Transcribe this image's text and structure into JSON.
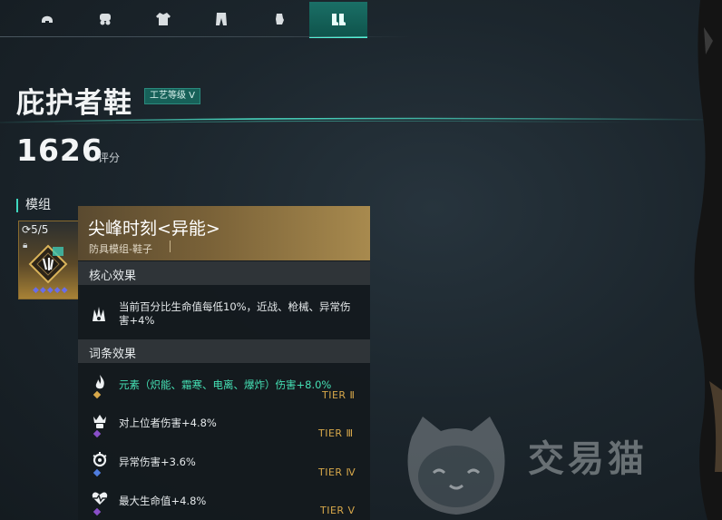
{
  "tabs": [
    {
      "icon": "helmet-icon",
      "active": false
    },
    {
      "icon": "mask-icon",
      "active": false
    },
    {
      "icon": "jacket-icon",
      "active": false
    },
    {
      "icon": "pants-icon",
      "active": false
    },
    {
      "icon": "glove-icon",
      "active": false
    },
    {
      "icon": "boots-icon",
      "active": true
    }
  ],
  "item": {
    "name": "庇护者鞋",
    "craft_level": "工艺等级 V",
    "score": "1626",
    "score_label": "评分"
  },
  "module_section": {
    "label": "模组",
    "slot_count": "5/5"
  },
  "tooltip": {
    "name": "尖峰时刻<异能>",
    "subtitle": "防具模组-鞋子",
    "core_header": "核心效果",
    "core_text": "当前百分比生命值每低10%，近战、枪械、异常伤害+4%",
    "affix_header": "词条效果",
    "affixes": [
      {
        "text": "元素（炽能、霜寒、电离、爆炸）伤害+8.0%",
        "tier": "TIER Ⅱ",
        "highlight": true,
        "icon": "flame-icon",
        "dot_color": "#d8a84a"
      },
      {
        "text": "对上位者伤害+4.8%",
        "tier": "TIER Ⅲ",
        "highlight": false,
        "icon": "crown-skull-icon",
        "dot_color": "#8a4fc9"
      },
      {
        "text": "异常伤害+3.6%",
        "tier": "TIER Ⅳ",
        "highlight": false,
        "icon": "anomaly-icon",
        "dot_color": "#4f7de0"
      },
      {
        "text": "最大生命值+4.8%",
        "tier": "TIER Ⅴ",
        "highlight": false,
        "icon": "heart-pulse-icon",
        "dot_color": "#8a4fc9"
      }
    ]
  },
  "watermark": {
    "text": "交易猫",
    "icon": "cat-logo-icon"
  },
  "colors": {
    "accent": "#4ff2d6",
    "gold": "#d8a84a",
    "highlight_green": "#45e0b4"
  }
}
